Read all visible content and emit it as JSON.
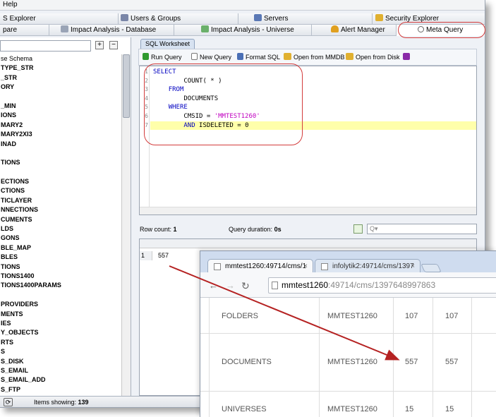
{
  "menubar": {
    "help_label": "Help"
  },
  "top_tabs": [
    {
      "label": "S Explorer",
      "icon": "explorer-icon"
    },
    {
      "label": "Users & Groups",
      "icon": "users-icon"
    },
    {
      "label": "Servers",
      "icon": "servers-icon"
    },
    {
      "label": "Security Explorer",
      "icon": "key-icon"
    }
  ],
  "sub_tabs": [
    {
      "label": "pare"
    },
    {
      "label": "Impact Analysis - Database",
      "icon": "impact-db-icon"
    },
    {
      "label": "Impact Analysis - Universe",
      "icon": "impact-universe-icon"
    },
    {
      "label": "Alert Manager",
      "icon": "bell-icon"
    },
    {
      "label": "Meta Query",
      "icon": "magnifier-icon",
      "active": true
    }
  ],
  "left_panel": {
    "schema_items": [
      "se Schema",
      "TYPE_STR",
      "_STR",
      "ORY",
      "",
      "_MIN",
      "IONS",
      "MARY2",
      "MARY2XI3",
      "INAD",
      "",
      "TIONS",
      "",
      "ECTIONS",
      "CTIONS",
      "TICLAYER",
      "NNECTIONS",
      "CUMENTS",
      "LDS",
      "GONS",
      "BLE_MAP",
      "BLES",
      "TIONS",
      "TIONS1400",
      "TIONS1400PARAMS",
      "",
      "PROVIDERS",
      "MENTS",
      "IES",
      "Y_OBJECTS",
      "RTS",
      "S",
      "S_DISK",
      "S_EMAIL",
      "S_EMAIL_ADD",
      "S_FTP"
    ]
  },
  "worksheet": {
    "tab_label": "SQL Worksheet",
    "toolbar": {
      "run_query": "Run Query",
      "new_query": "New Query",
      "format_sql": "Format SQL",
      "open_mmdb": "Open from MMDB",
      "open_disk": "Open from Disk"
    },
    "sql_lines": [
      {
        "n": "1",
        "text": "SELECT"
      },
      {
        "n": "2",
        "text": "        COUNT( * )"
      },
      {
        "n": "3",
        "text": "    FROM"
      },
      {
        "n": "4",
        "text": "        DOCUMENTS"
      },
      {
        "n": "5",
        "text": "    WHERE"
      },
      {
        "n": "6",
        "text": "        CMSID = 'MMTEST1260'"
      },
      {
        "n": "7",
        "text": "        AND ISDELETED = 0"
      }
    ],
    "row_count_label": "Row count:",
    "row_count": "1",
    "duration_label": "Query duration:",
    "duration": "0s",
    "result_search_placeholder": "Q▾",
    "results": [
      {
        "row": "1",
        "value": "557"
      }
    ]
  },
  "status": {
    "items_label": "Items showing:",
    "items_count": "139"
  },
  "browser": {
    "tabs": [
      {
        "label": "mmtest1260:49714/cms/1",
        "active": true
      },
      {
        "label": "infolytik2:49714/cms/1397",
        "active": false
      }
    ],
    "url_host": "mmtest1260",
    "url_rest": ":49714/cms/1397648997863",
    "rows": [
      {
        "type": "FOLDERS",
        "cms": "MMTEST1260",
        "a": "107",
        "b": "107"
      },
      {
        "type": "DOCUMENTS",
        "cms": "MMTEST1260",
        "a": "557",
        "b": "557"
      },
      {
        "type": "UNIVERSES",
        "cms": "MMTEST1260",
        "a": "15",
        "b": "15"
      }
    ]
  },
  "colors": {
    "annotation": "#d33b3b",
    "keyword": "#0000c0",
    "string": "#c000c0",
    "highlight": "#ffffaa"
  }
}
